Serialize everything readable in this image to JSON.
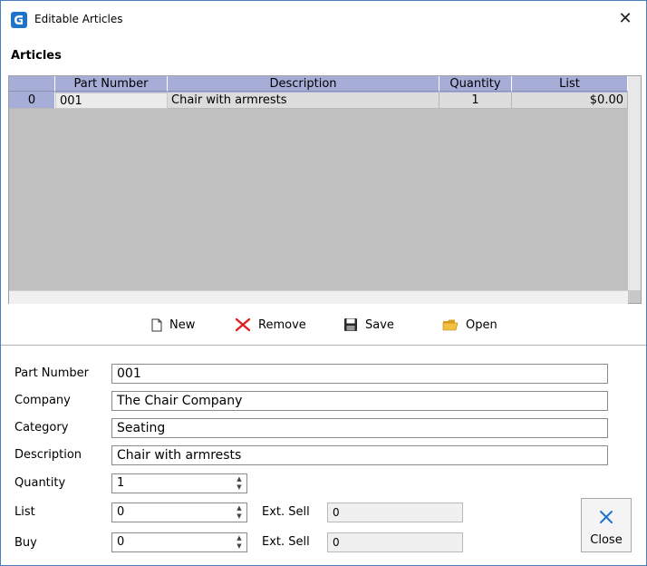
{
  "window": {
    "title": "Editable Articles"
  },
  "section": {
    "title": "Articles"
  },
  "grid": {
    "columns": [
      "",
      "Part Number",
      "Description",
      "Quantity",
      "List"
    ],
    "rows": [
      {
        "row_index": "0",
        "part_number": "001",
        "description": "Chair with armrests",
        "quantity": "1",
        "list": "$0.00"
      }
    ]
  },
  "toolbar": {
    "new_label": "New",
    "remove_label": "Remove",
    "save_label": "Save",
    "open_label": "Open"
  },
  "form": {
    "part_number": {
      "label": "Part Number",
      "value": "001"
    },
    "company": {
      "label": "Company",
      "value": "The Chair Company"
    },
    "category": {
      "label": "Category",
      "value": "Seating"
    },
    "description": {
      "label": "Description",
      "value": "Chair with armrests"
    },
    "quantity": {
      "label": "Quantity",
      "value": "1"
    },
    "list": {
      "label": "List",
      "value": "0",
      "ext_label": "Ext. Sell",
      "ext_value": "0"
    },
    "buy": {
      "label": "Buy",
      "value": "0",
      "ext_label": "Ext. Sell",
      "ext_value": "0"
    }
  },
  "close_button": {
    "label": "Close"
  },
  "colors": {
    "header": "#a6aed8",
    "grid_bg": "#c0c0c0",
    "accent": "#1f73c9",
    "remove_red": "#e02020"
  }
}
